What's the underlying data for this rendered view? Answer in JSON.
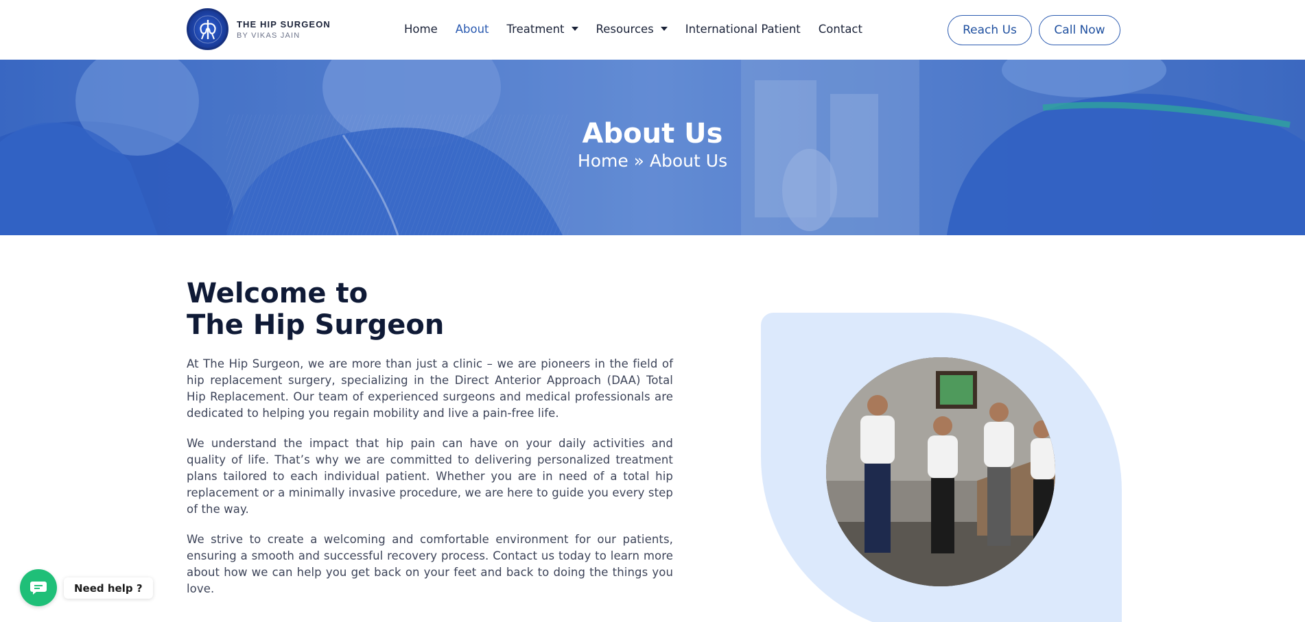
{
  "header": {
    "logo": {
      "title": "THE HIP SURGEON",
      "subtitle": "BY VIKAS JAIN"
    },
    "nav": [
      {
        "label": "Home",
        "active": false,
        "dropdown": false
      },
      {
        "label": "About",
        "active": true,
        "dropdown": false
      },
      {
        "label": "Treatment",
        "active": false,
        "dropdown": true
      },
      {
        "label": "Resources",
        "active": false,
        "dropdown": true
      },
      {
        "label": "International Patient",
        "active": false,
        "dropdown": false
      },
      {
        "label": "Contact",
        "active": false,
        "dropdown": false
      }
    ],
    "buttons": {
      "reach": "Reach Us",
      "call": "Call Now"
    }
  },
  "hero": {
    "title": "About Us",
    "breadcrumb": "Home » About Us"
  },
  "welcome": {
    "title_line1": "Welcome to",
    "title_line2": "The Hip Surgeon",
    "paragraphs": [
      "At The Hip Surgeon, we are more than just a clinic – we are pioneers in the field of hip replacement surgery, specializing in the Direct Anterior Approach (DAA) Total Hip Replacement. Our team of experienced surgeons and medical professionals are dedicated to helping you regain mobility and live a pain-free life.",
      "We understand the impact that hip pain can have on your daily activities and quality of life. That’s why we are committed to delivering personalized treatment plans tailored to each individual patient. Whether you are in need of a total hip replacement or a minimally invasive procedure, we are here to guide you every step of the way.",
      "We strive to create a welcoming and comfortable environment for our patients, ensuring a smooth and successful recovery process. Contact us today to learn more about how we can help you get back on your feet and back to doing the things you love."
    ]
  },
  "help_widget": {
    "label": "Need help ?",
    "icon": "chat-icon"
  },
  "colors": {
    "accent": "#2a5ab0",
    "heading": "#0f1a36",
    "panel": "#dce9fc",
    "help": "#1fbf78"
  }
}
